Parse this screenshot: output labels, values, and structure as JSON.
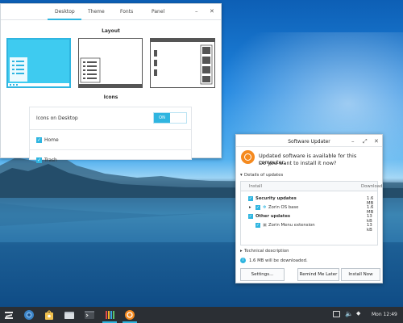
{
  "settings": {
    "tabs": [
      "Desktop",
      "Theme",
      "Fonts",
      "Panel"
    ],
    "active_tab": "Desktop",
    "layout_title": "Layout",
    "icons_title": "Icons",
    "icons_on_desktop_label": "Icons on Desktop",
    "toggle_label": "ON",
    "home_label": "Home",
    "trash_label": "Trash"
  },
  "updater": {
    "title": "Software Updater",
    "message_line1": "Updated software is available for this computer.",
    "message_line2": "Do you want to install it now?",
    "details_label": "Details of updates",
    "col_install": "Install",
    "col_download": "Download",
    "rows": [
      {
        "label": "Security updates",
        "size": "1.6 MB",
        "bold": true
      },
      {
        "label": "Zorin OS base",
        "size": "1.6 MB",
        "bold": false
      },
      {
        "label": "Other updates",
        "size": "13 kB",
        "bold": true
      },
      {
        "label": "Zorin Menu extension",
        "size": "13 kB",
        "bold": false
      }
    ],
    "technical_label": "Technical description",
    "download_info": "1.6 MB will be downloaded.",
    "buttons": {
      "settings": "Settings...",
      "remind": "Remind Me Later",
      "install": "Install Now"
    }
  },
  "taskbar": {
    "clock": "Mon 12:49",
    "icons": [
      "zorin-menu-icon",
      "browser-icon",
      "software-store-icon",
      "files-icon",
      "terminal-icon",
      "appearance-icon",
      "software-updater-icon"
    ]
  },
  "colors": {
    "accent": "#2fb5e0",
    "taskbar": "#2b2f34",
    "updater_logo": "#f58a1f"
  }
}
